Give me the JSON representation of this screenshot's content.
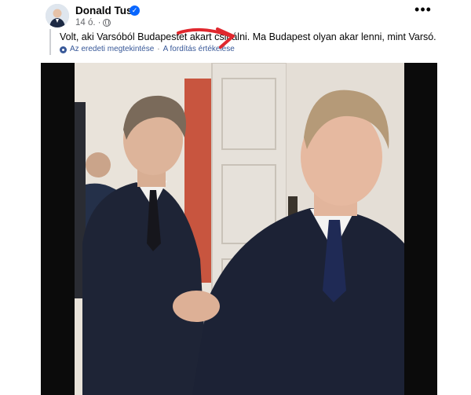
{
  "post": {
    "author": "Donald Tusk",
    "timestamp": "14 ó.",
    "dot": "·",
    "text": "Volt, aki Varsóból Budapestet akart csinálni. Ma Budapest olyan akar lenni, mint Varsó.",
    "translation": {
      "view_original": "Az eredeti megtekintése",
      "separator": "·",
      "rate_translation": "A fordítás értékelése"
    },
    "more_label": "•••",
    "verified_mark": "✓"
  },
  "icons": {
    "verified": "verified-badge-icon",
    "privacy": "globe-icon",
    "translation": "gear-icon",
    "more": "more-dots-icon"
  },
  "colors": {
    "link": "#385898",
    "verified": "#0866ff",
    "annotation_arrow": "#e0282e",
    "photo_border": "#0b0b0b"
  }
}
